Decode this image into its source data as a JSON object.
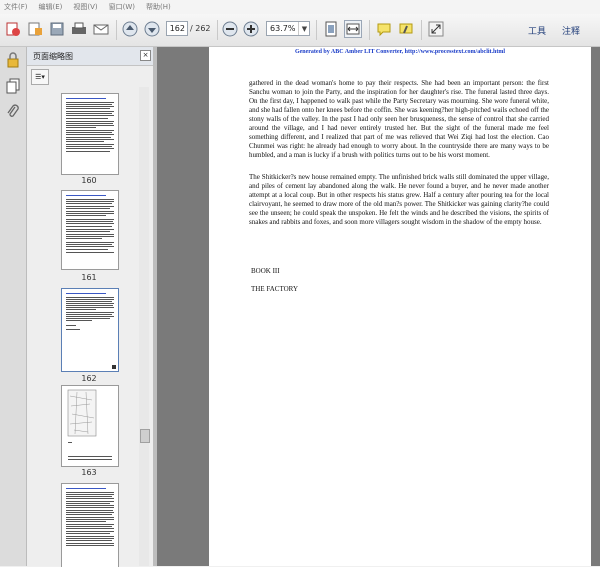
{
  "menu": {
    "items": [
      "文件(F)",
      "编辑(E)",
      "视图(V)",
      "窗口(W)",
      "帮助(H)"
    ]
  },
  "toolbar": {
    "current_page": "162",
    "total_pages": "/ 262",
    "zoom": "63.7%",
    "tools_label": "工具",
    "comment_label": "注释",
    "icons": [
      "create-pdf-icon",
      "edit-icon",
      "save-icon",
      "print-icon",
      "email-icon",
      "prev-page-icon",
      "next-page-icon",
      "zoom-out-icon",
      "zoom-in-icon",
      "fit-page-icon",
      "fit-width-icon",
      "comment-icon",
      "highlight-icon",
      "expand-icon"
    ]
  },
  "panel": {
    "title": "页面缩略图",
    "close_label": "×",
    "thumb_labels": [
      "160",
      "161",
      "162",
      "163"
    ]
  },
  "document": {
    "header": "Generated by ABC Amber LIT Converter, http://www.processtext.com/abclit.html",
    "paragraph1": "gathered in the dead woman's home to pay their respects. She had been an important person: the first Sanchu woman to join the Party, and the inspiration for her daughter's rise. The funeral lasted three days. On the first day, I happened to walk past while the Party Secretary was mourning. She wore funeral white, and she had fallen onto her knees before the coffin. She was keening?her high-pitched wails echoed off the stony walls of the valley. In the past I had only seen her brusqueness, the sense of control that she carried around the village, and I had never entirely trusted her. But the sight of the funeral made me feel something different, and I realized that part of me was relieved that Wei Ziqi had lost the election. Cao Chunmei was right: he already had enough to worry about. In the countryside there are many ways to be humbled, and a man is lucky if a brush with politics turns out to be his worst moment.",
    "paragraph2": "The Shitkicker?s new house remained empty. The unfinished brick walls still dominated the upper village, and piles of cement lay abandoned along the walk. He never found a buyer, and he never made another attempt at a local coup. But in other respects his status grew. Half a century after pouring tea for the local clairvoyant, he seemed to draw more of the old man?s power. The Shitkicker was gaining clarity?he could see the unseen; he could speak the unspoken. He felt the winds and he described the visions, the spirits of snakes and rabbits and foxes, and soon more villagers sought wisdom in the shadow of the empty house.",
    "book_heading": "BOOK III",
    "section_heading": "THE FACTORY"
  }
}
